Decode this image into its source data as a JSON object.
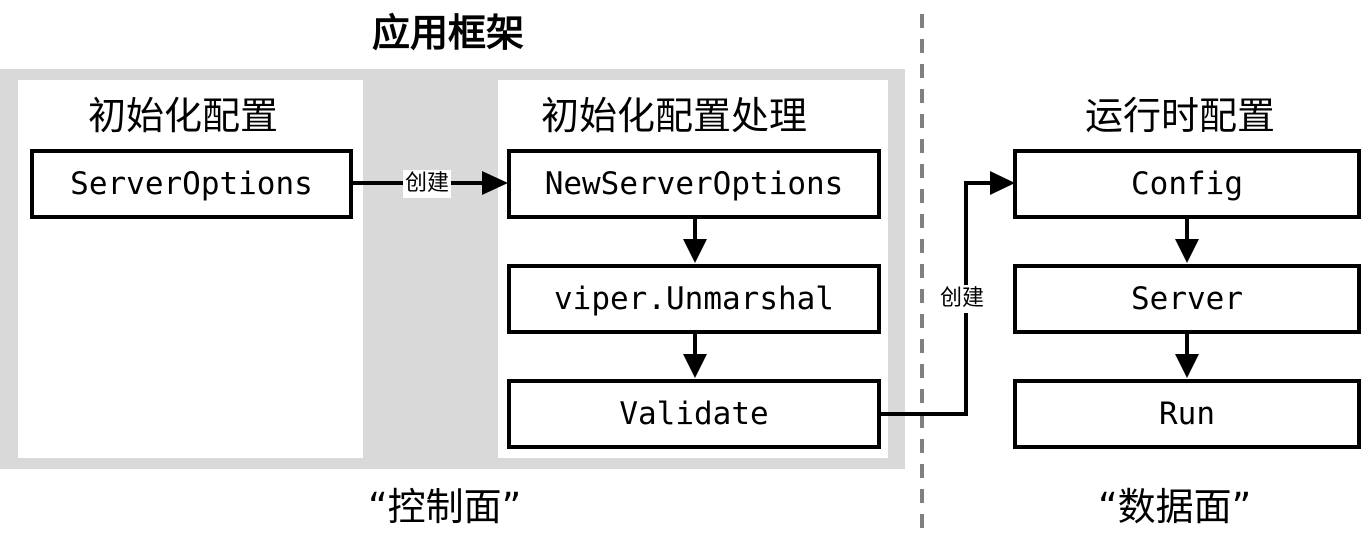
{
  "title": "应用框架",
  "columns": {
    "init_config": {
      "title": "初始化配置",
      "nodes": [
        "ServerOptions"
      ]
    },
    "init_processing": {
      "title": "初始化配置处理",
      "nodes": [
        "NewServerOptions",
        "viper.Unmarshal",
        "Validate"
      ]
    },
    "runtime_config": {
      "title": "运行时配置",
      "nodes": [
        "Config",
        "Server",
        "Run"
      ]
    }
  },
  "edges": {
    "create_label_1": "创建",
    "create_label_2": "创建"
  },
  "planes": {
    "control": "“控制面”",
    "data": "“数据面”"
  },
  "colors": {
    "panel_background": "#d9d9d9",
    "stroke": "#000000",
    "divider": "#808080"
  }
}
